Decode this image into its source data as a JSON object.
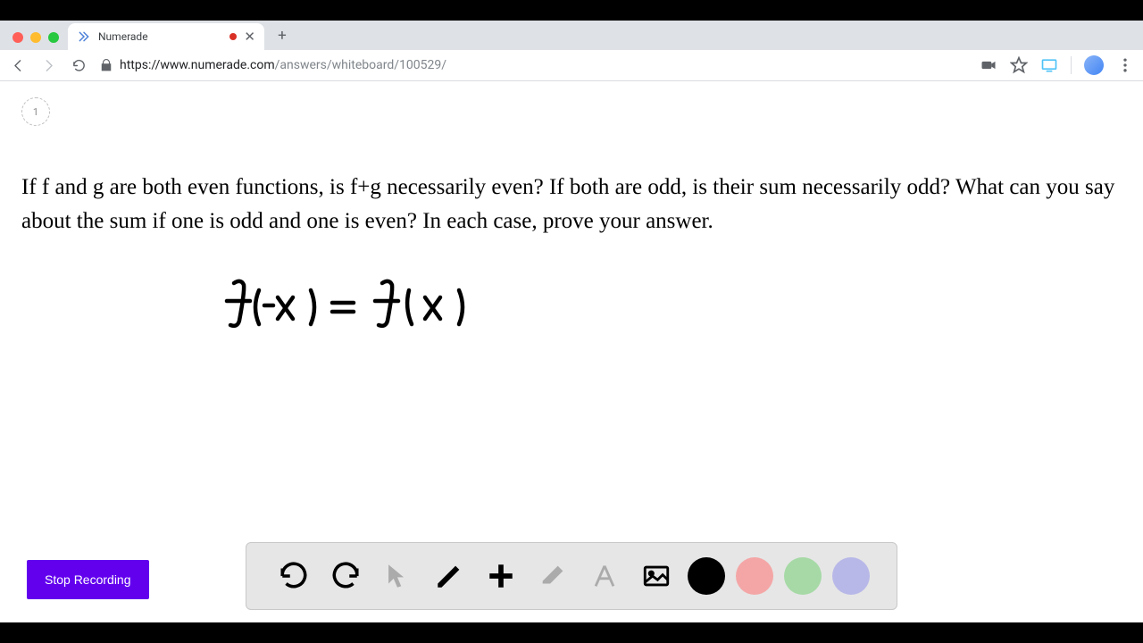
{
  "browser": {
    "tab_title": "Numerade",
    "url_host": "https://www.numerade.com",
    "url_path": "/answers/whiteboard/100529/"
  },
  "page": {
    "indicator": "1",
    "question": "If f and g are both even functions, is f+g necessarily even? If both are odd, is their sum necessarily odd? What can you say about the sum if one is odd and one is even? In each case, prove your answer.",
    "handwritten_equation": "f(-x) = f(x)"
  },
  "controls": {
    "stop_recording": "Stop Recording"
  },
  "toolbar": {
    "colors": {
      "black": "#000000",
      "pink": "#f4a6a6",
      "green": "#a6d9a6",
      "purple": "#b8b8e8"
    }
  }
}
